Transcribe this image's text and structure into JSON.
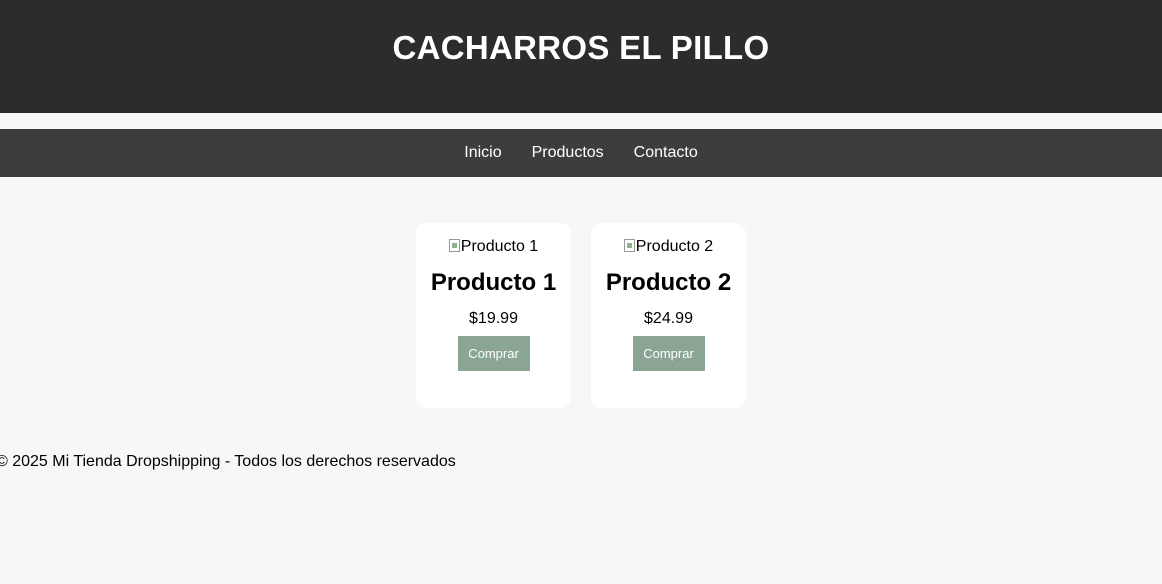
{
  "header": {
    "title": "CACHARROS EL PILLO"
  },
  "nav": {
    "items": [
      {
        "label": "Inicio"
      },
      {
        "label": "Productos"
      },
      {
        "label": "Contacto"
      }
    ]
  },
  "products": [
    {
      "image_alt": "Producto 1",
      "name": "Producto 1",
      "price": "$19.99",
      "button_label": "Comprar"
    },
    {
      "image_alt": "Producto 2",
      "name": "Producto 2",
      "price": "$24.99",
      "button_label": "Comprar"
    }
  ],
  "footer": {
    "text": "© 2025 Mi Tienda Dropshipping - Todos los derechos reservados"
  },
  "colors": {
    "header_bg": "#2c2c2c",
    "nav_bg": "#3d3d3d",
    "page_bg": "#f7f7f7",
    "button_bg": "#8aa594"
  }
}
